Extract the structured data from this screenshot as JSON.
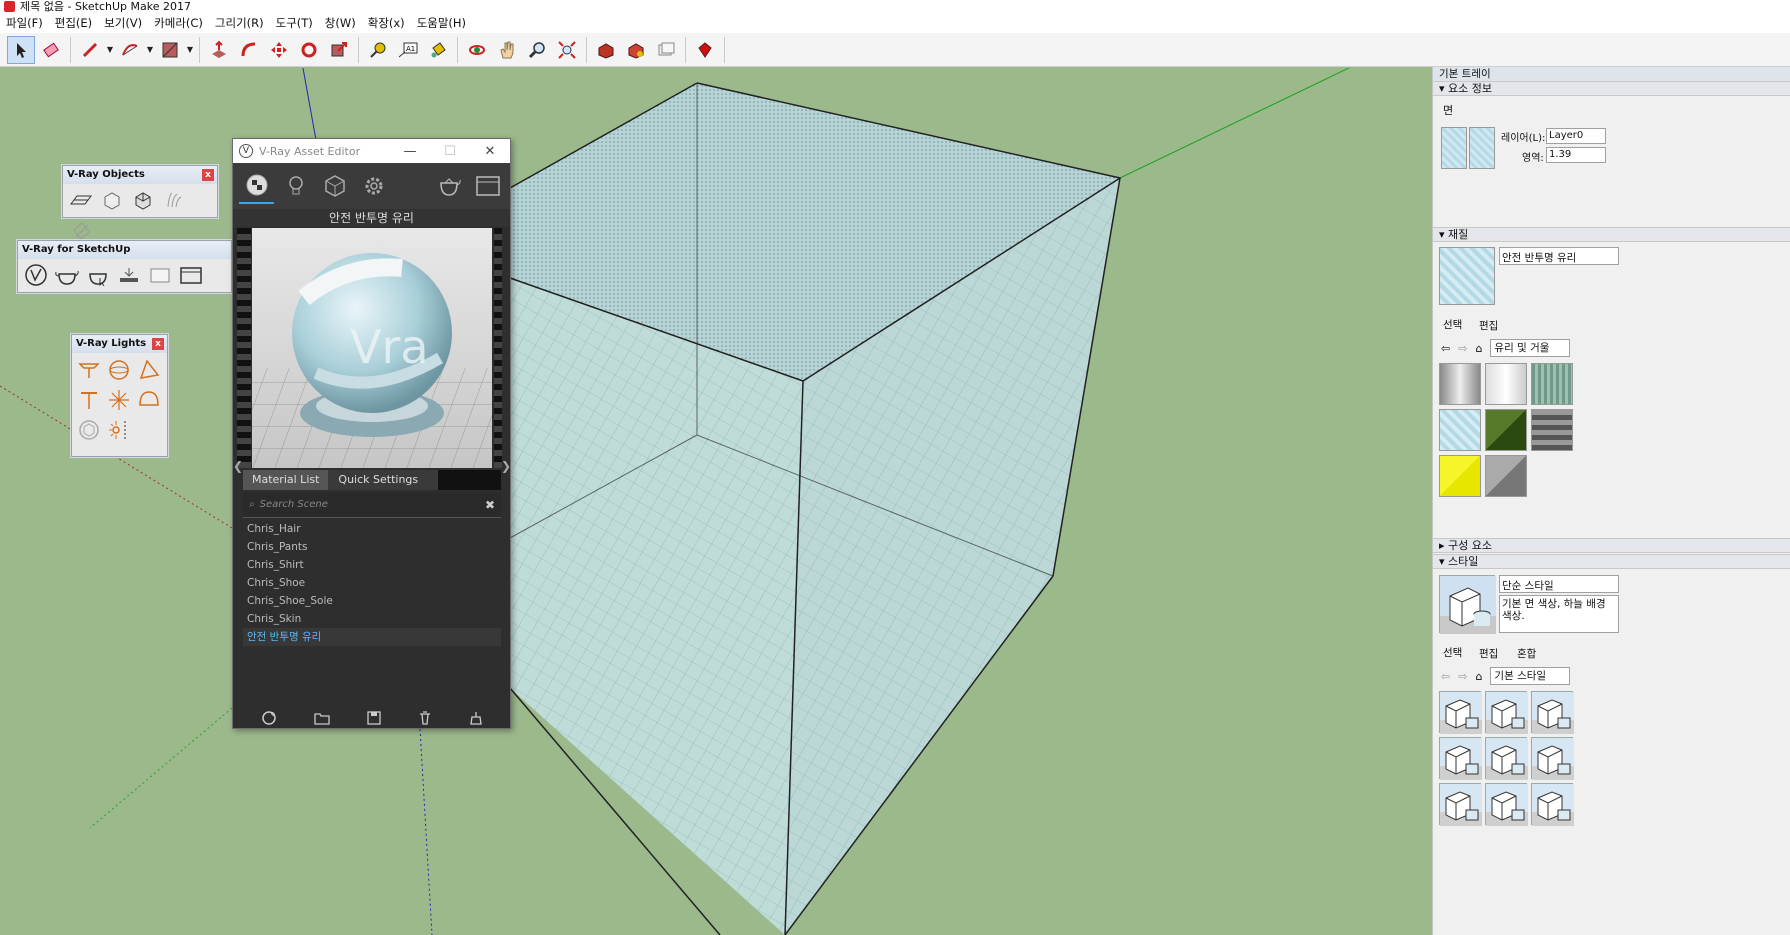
{
  "window": {
    "title": "제목 없음 - SketchUp Make 2017"
  },
  "menu": {
    "items": [
      "파일(F)",
      "편집(E)",
      "보기(V)",
      "카메라(C)",
      "그리기(R)",
      "도구(T)",
      "창(W)",
      "확장(x)",
      "도움말(H)"
    ]
  },
  "toolbar": {
    "tools": [
      "select-tool",
      "eraser-tool",
      "pencil-tool",
      "arc-tool",
      "rectangle-tool",
      "push-pull-tool",
      "follow-me-tool",
      "move-tool",
      "rotate-tool",
      "scale-tool",
      "tape-measure-tool",
      "text-tool",
      "paint-bucket-tool",
      "orbit-tool",
      "pan-tool",
      "zoom-tool",
      "zoom-extents-tool",
      "warehouse-tool",
      "extension-warehouse-tool",
      "send-to-layout-tool",
      "extension-manager-tool"
    ],
    "text_tool_label": "A1"
  },
  "vray_objects": {
    "title": "V-Ray Objects",
    "close": "x"
  },
  "vray_sketchup": {
    "title": "V-Ray for SketchUp"
  },
  "vray_lights": {
    "title": "V-Ray Lights",
    "close": "x"
  },
  "asset_editor": {
    "title": "V-Ray Asset Editor",
    "material_name": "안전 반투명 유리",
    "tabs": {
      "list": "Material List",
      "quick": "Quick Settings"
    },
    "search_placeholder": "Search Scene",
    "materials": [
      "Chris_Hair",
      "Chris_Pants",
      "Chris_Shirt",
      "Chris_Shoe",
      "Chris_Shoe_Sole",
      "Chris_Skin",
      "안전 반투명 유리"
    ],
    "selected_material": "안전 반투명 유리",
    "preview_text": "Vra"
  },
  "tray": {
    "title": "기본 트레이",
    "entity_info": {
      "header": "요소 정보",
      "type": "면",
      "layer_label": "레이어(L):",
      "layer_value": "Layer0",
      "area_label": "영역:",
      "area_value": "1.39"
    },
    "materials": {
      "header": "재질",
      "current": "안전 반투명 유리",
      "tab_select": "선택",
      "tab_edit": "편집",
      "library": "유리 및 거울"
    },
    "components": {
      "header": "구성 요소"
    },
    "styles": {
      "header": "스타일",
      "name": "단순 스타일",
      "description": "기본 면 색상, 하늘 배경 색상.",
      "tab_select": "선택",
      "tab_edit": "편집",
      "tab_mix": "혼합",
      "library": "기본 스타일"
    }
  },
  "colors": {
    "viewport": "#9cb98c",
    "glass": "#b9d8d4",
    "accent": "#3fa3e0"
  }
}
